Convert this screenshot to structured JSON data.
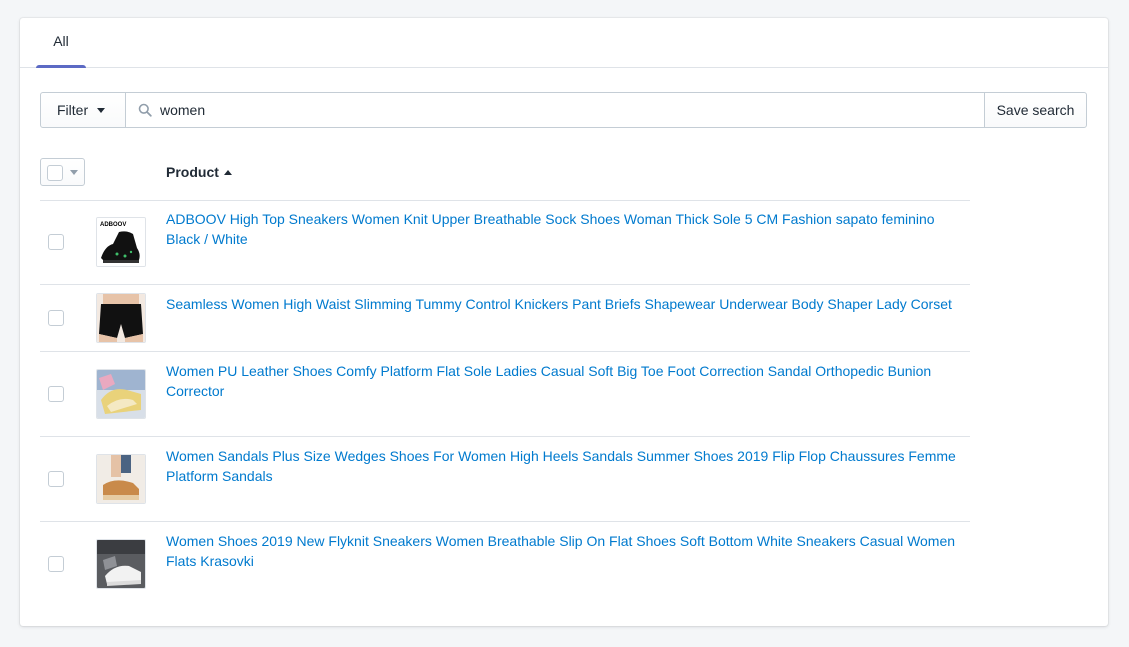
{
  "tabs": [
    {
      "label": "All"
    }
  ],
  "filter": {
    "filter_label": "Filter",
    "search_value": "women",
    "save_label": "Save search"
  },
  "table": {
    "product_header": "Product",
    "sort": "ascending",
    "rows": [
      {
        "title": "ADBOOV High Top Sneakers Women Knit Upper Breathable Sock Shoes Woman Thick Sole 5 CM Fashion sapato feminino Black / White",
        "thumb_brand": "ADBOOV"
      },
      {
        "title": "Seamless Women High Waist Slimming Tummy Control Knickers Pant Briefs Shapewear Underwear Body Shaper Lady Corset"
      },
      {
        "title": "Women PU Leather Shoes Comfy Platform Flat Sole Ladies Casual Soft Big Toe Foot Correction Sandal Orthopedic Bunion Corrector"
      },
      {
        "title": "Women Sandals Plus Size Wedges Shoes For Women High Heels Sandals Summer Shoes 2019 Flip Flop Chaussures Femme Platform Sandals"
      },
      {
        "title": "Women Shoes 2019 New Flyknit Sneakers Women Breathable Slip On Flat Shoes Soft Bottom White Sneakers Casual Women Flats Krasovki"
      }
    ]
  },
  "colors": {
    "accent": "#5c6ac4",
    "link": "#007ace",
    "border": "#dfe3e8",
    "background": "#f4f6f8"
  }
}
